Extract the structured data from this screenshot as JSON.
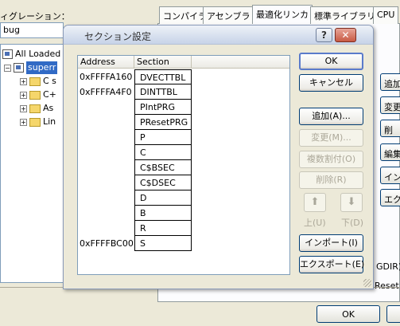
{
  "background": {
    "top_label": "ィグレーション：",
    "combo_value": "bug",
    "tree": {
      "root": "All Loaded",
      "project": "superr",
      "children": [
        "C s",
        "C+",
        "As",
        "Lin"
      ]
    },
    "tabs": [
      "コンパイラ",
      "アセンブラ",
      "最適化リンカ",
      "標準ライブラリ",
      "CPU"
    ],
    "right_buttons": [
      "追加",
      "変更",
      "削",
      "編集",
      "インポ",
      "エクスポ"
    ],
    "right_texts": [
      "GDIR)",
      "Reset"
    ],
    "ok_label": "OK"
  },
  "dialog": {
    "title": "セクション設定",
    "help_glyph": "?",
    "close_glyph": "✕",
    "columns": [
      "Address",
      "Section"
    ],
    "rows": [
      {
        "address": "0xFFFFA160",
        "section": "DVECTTBL"
      },
      {
        "address": "0xFFFFA4F0",
        "section": "DINTTBL"
      },
      {
        "address": "",
        "section": "PIntPRG"
      },
      {
        "address": "",
        "section": "PResetPRG"
      },
      {
        "address": "",
        "section": "P"
      },
      {
        "address": "",
        "section": "C"
      },
      {
        "address": "",
        "section": "C$BSEC"
      },
      {
        "address": "",
        "section": "C$DSEC"
      },
      {
        "address": "",
        "section": "D"
      },
      {
        "address": "",
        "section": "B"
      },
      {
        "address": "",
        "section": "R"
      },
      {
        "address": "0xFFFFBC00",
        "section": "S"
      }
    ],
    "buttons": {
      "ok": "OK",
      "cancel": "キャンセル",
      "add": "追加(A)...",
      "change": "変更(M)...",
      "multi_assign": "複数割付(O)",
      "delete": "削除(R)",
      "up": "上(U)",
      "down": "下(D)",
      "import": "インポート(I)",
      "export": "エクスポート(E)"
    },
    "up_glyph": "⬆",
    "down_glyph": "⬇"
  },
  "colors": {
    "face": "#ece9d8",
    "selection": "#316ac5",
    "close_red": "#c85a44"
  }
}
